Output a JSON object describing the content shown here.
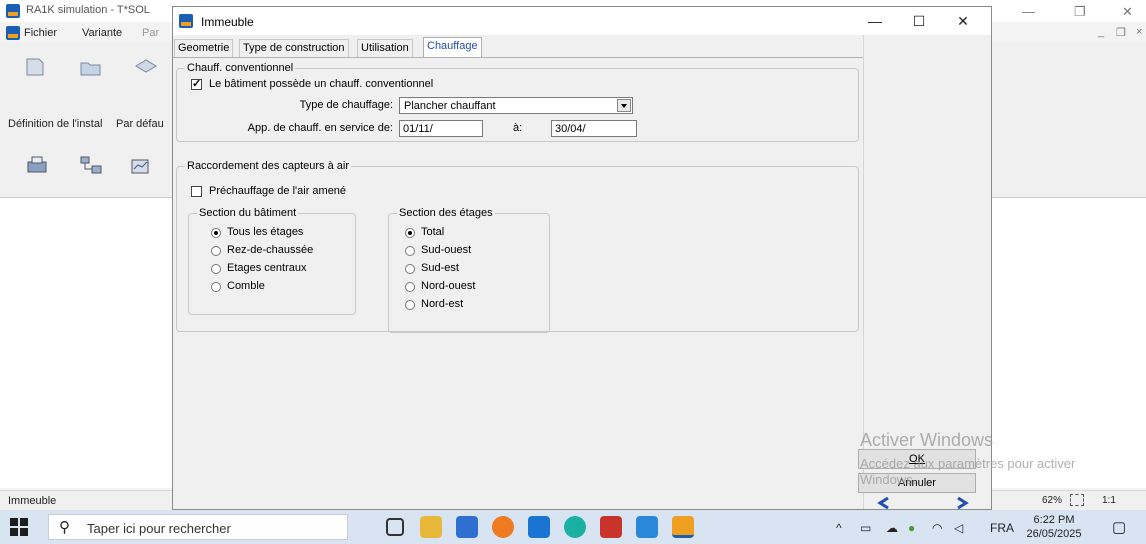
{
  "background_app": {
    "title": "RA1K simulation - T*SOL",
    "menu": [
      "Fichier",
      "Variante",
      "Par"
    ],
    "side_labels": [
      "Définition de l'instal",
      "Par défau"
    ],
    "status_text": "Immeuble",
    "zoom": "62%",
    "ratio": "1:1"
  },
  "dialog": {
    "title": "Immeuble",
    "minimize": "—",
    "maximize": "☐",
    "close": "✕",
    "tabs": [
      "Geometrie",
      "Type de construction",
      "Utilisation",
      "Chauffage"
    ],
    "active_tab": "Chauffage",
    "group_chauff": {
      "title": "Chauff. conventionnel",
      "checkbox_label": "Le bâtiment possède un chauff. conventionnel",
      "checked": true,
      "type_label": "Type de chauffage:",
      "type_value": "Plancher chauffant",
      "service_label": "App. de chauff. en service de:",
      "from_value": "01/11/",
      "to_label": "à:",
      "to_value": "30/04/"
    },
    "group_capteurs": {
      "title": "Raccordement des capteurs à air",
      "preheat_label": "Préchauffage de l'air amené",
      "preheat_checked": false,
      "section_batiment": {
        "title": "Section du bâtiment",
        "options": [
          "Tous les étages",
          "Rez-de-chaussée",
          "Etages centraux",
          "Comble"
        ],
        "selected": "Tous les étages"
      },
      "section_etages": {
        "title": "Section des étages",
        "options": [
          "Total",
          "Sud-ouest",
          "Sud-est",
          "Nord-ouest",
          "Nord-est"
        ],
        "selected": "Total"
      }
    },
    "ok_label": "OK",
    "cancel_label": "Annuler"
  },
  "watermark": {
    "line1": "Activer Windows",
    "line2": "Accédez aux paramètres pour activer",
    "line3": "Windows."
  },
  "taskbar": {
    "search_placeholder": "Taper ici pour rechercher",
    "language": "FRA",
    "time": "6:22 PM",
    "date": "26/05/2025"
  },
  "colors": {
    "active_tab_text": "#1f4fb0",
    "taskbar_bg": "#d9e4f3",
    "dialog_bg": "#f0f0f0"
  }
}
